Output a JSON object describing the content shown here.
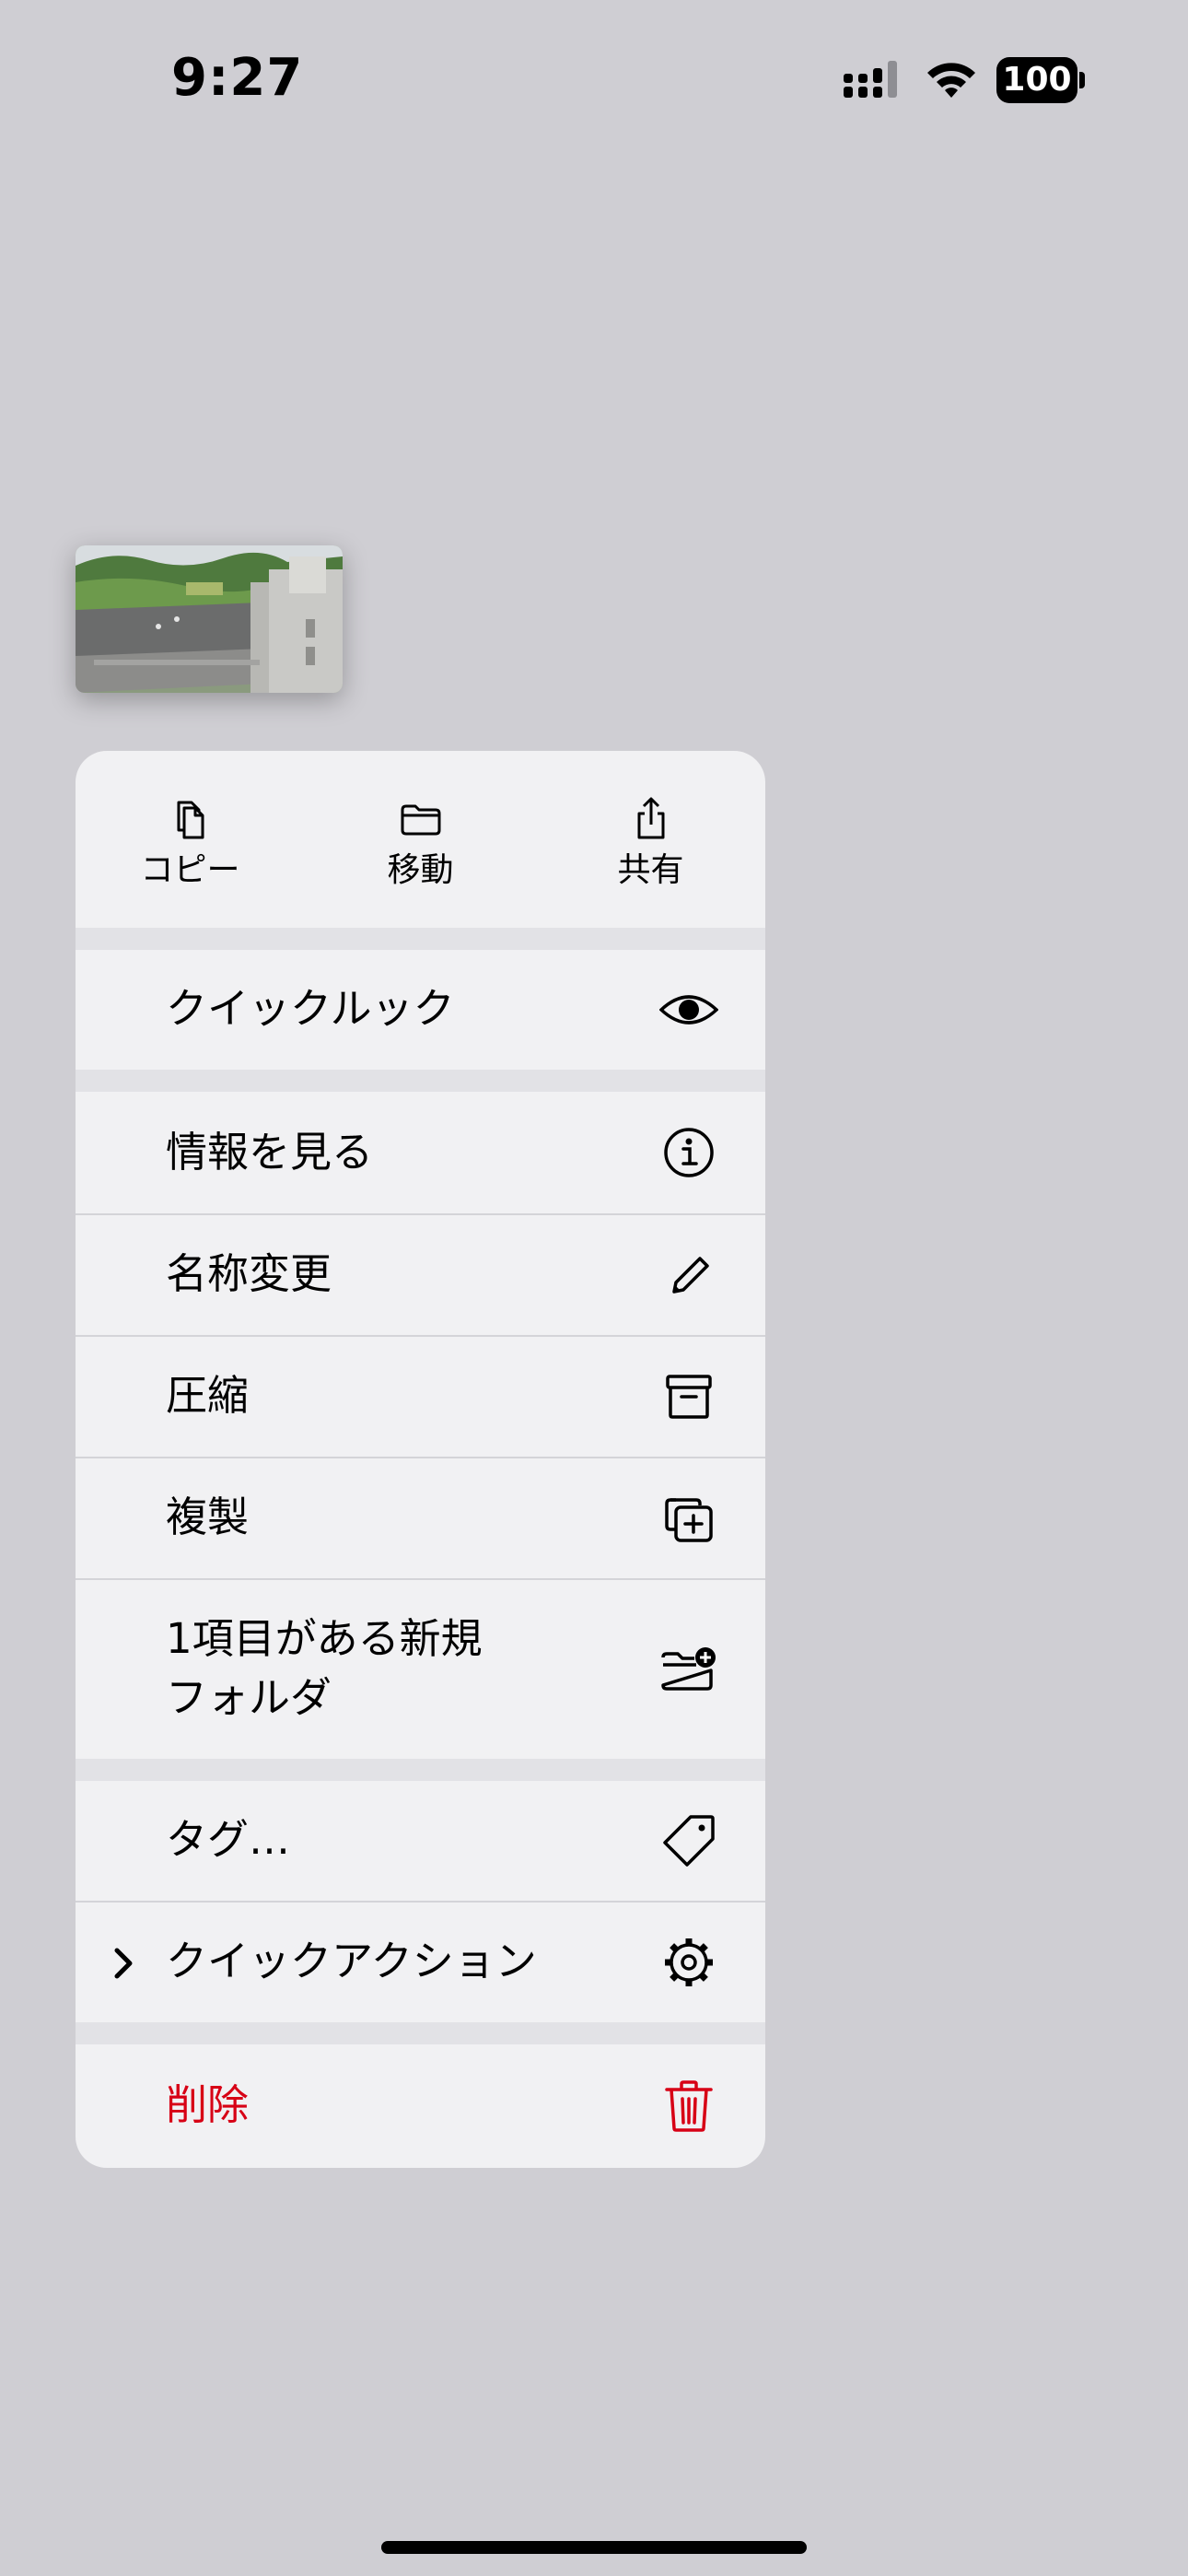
{
  "status_bar": {
    "time": "9:27",
    "battery": "100"
  },
  "thumbnail": {
    "icon": "photo-thumbnail"
  },
  "menu": {
    "top_actions": [
      {
        "label": "コピー",
        "icon": "copy-icon"
      },
      {
        "label": "移動",
        "icon": "folder-icon"
      },
      {
        "label": "共有",
        "icon": "share-icon"
      }
    ],
    "items": {
      "quicklook": "クイックルック",
      "info": "情報を見る",
      "rename": "名称変更",
      "compress": "圧縮",
      "duplicate": "複製",
      "new_folder_line1": "1項目がある新規",
      "new_folder_line2": "フォルダ",
      "tags": "タグ…",
      "quick_actions": "クイックアクション",
      "delete": "削除"
    },
    "colors": {
      "destructive": "#d70015",
      "background": "#f1f1f3"
    }
  }
}
